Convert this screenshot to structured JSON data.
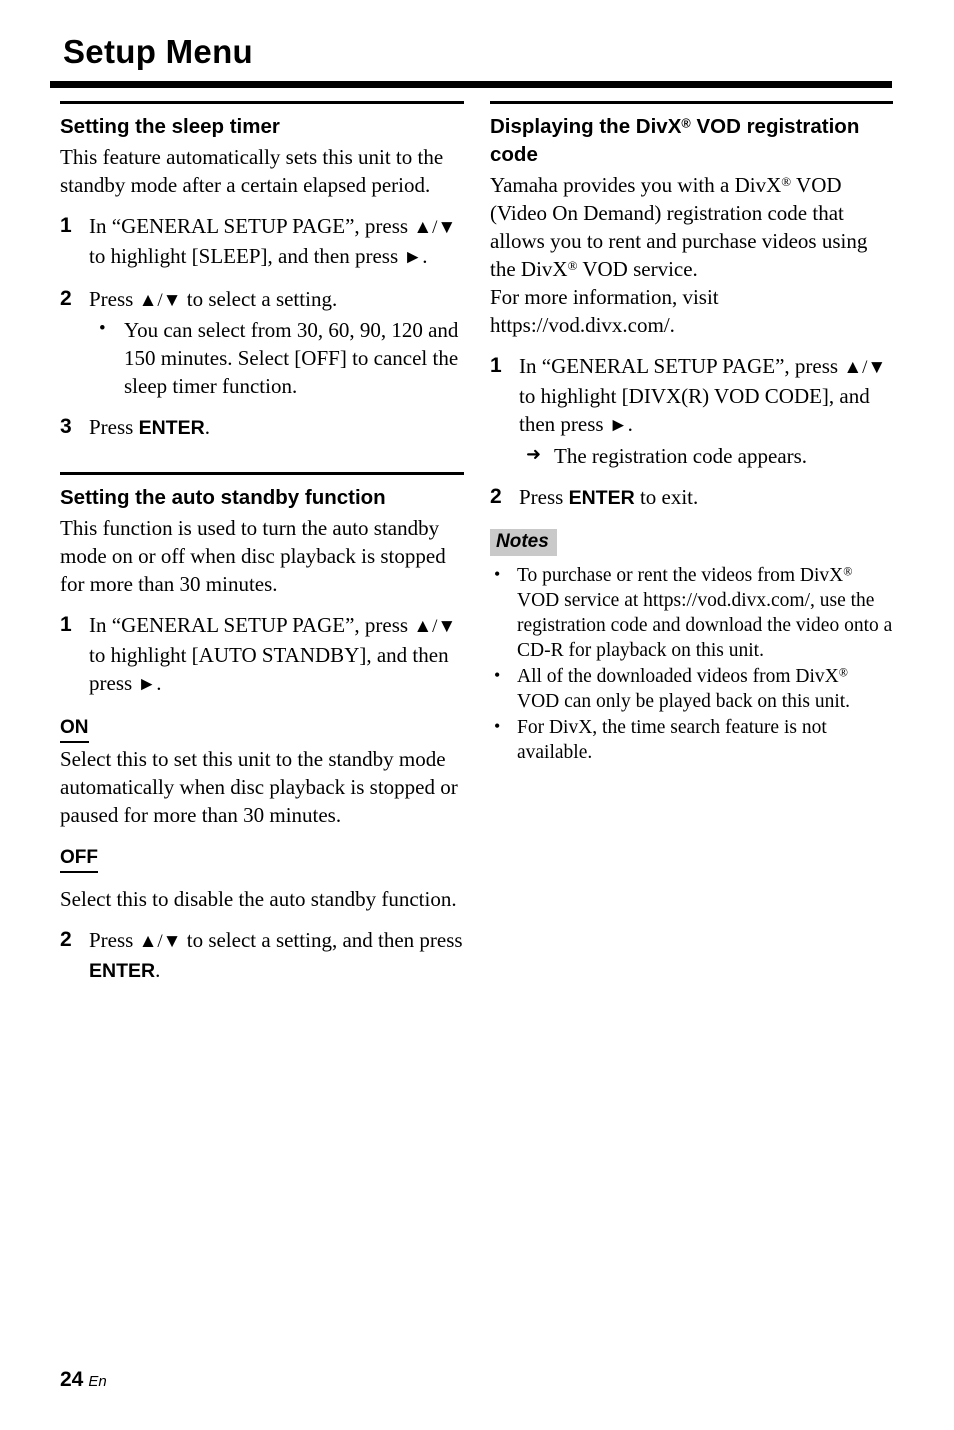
{
  "page": {
    "title": "Setup Menu",
    "footer_page_number": "24",
    "footer_language": "En"
  },
  "left_column": {
    "sections": [
      {
        "heading": "Setting the sleep timer",
        "intro": "This feature automatically sets this unit to the standby mode after a certain elapsed period.",
        "steps": [
          {
            "number": "1",
            "text_1": "In “GENERAL SETUP PAGE”, press ",
            "glyph_updown": "▲/▼",
            "text_2": " to highlight [SLEEP], and then press ",
            "glyph_right": "►",
            "text_3": "."
          },
          {
            "number": "2",
            "text_1": "Press ",
            "glyph_updown": "▲/▼",
            "text_2": " to select a setting.",
            "bullet": "•",
            "bullet_text": "You can select from 30, 60, 90, 120 and 150 minutes. Select [OFF] to cancel the sleep timer function."
          },
          {
            "number": "3",
            "text_1": "Press ",
            "kbd": "ENTER",
            "text_2": "."
          }
        ]
      },
      {
        "heading": "Setting the auto standby function",
        "intro": "This function is used to turn the auto standby mode on or off when disc playback is stopped for more than 30 minutes.",
        "steps": [
          {
            "number": "1",
            "text_1": "In “GENERAL SETUP PAGE”, press ",
            "glyph_updown": "▲/▼",
            "text_2": " to highlight [AUTO STANDBY], and then press ",
            "glyph_right": "►",
            "text_3": "."
          }
        ],
        "options": [
          {
            "label": "ON",
            "description": "Select this to set this unit to the standby mode automatically when disc playback is stopped or paused for more than 30 minutes."
          },
          {
            "label": "OFF",
            "description": "Select this to disable the auto standby function."
          }
        ],
        "final_step": {
          "number": "2",
          "text_1": "Press ",
          "glyph_updown": "▲/▼",
          "text_2": " to select a setting, and then press ",
          "kbd": "ENTER",
          "text_3": "."
        }
      }
    ]
  },
  "right_column": {
    "section": {
      "heading_part_1": "Displaying the DivX",
      "heading_reg": "®",
      "heading_part_2": " VOD registration code",
      "intro_1": "Yamaha provides you with a DivX",
      "intro_reg_1": "®",
      "intro_2": " VOD (Video On Demand) registration code that allows you to rent and purchase videos using the DivX",
      "intro_reg_2": "®",
      "intro_3": " VOD service.",
      "intro_4": "For more information, visit https://vod.divx.com/.",
      "steps": [
        {
          "number": "1",
          "text_1": "In “GENERAL SETUP PAGE”, press ",
          "glyph_updown": "▲/▼",
          "text_2": " to highlight [DIVX(R) VOD CODE], and then press ",
          "glyph_right": "►",
          "text_3": ".",
          "arrow": "➜",
          "result_text": "The registration code appears."
        },
        {
          "number": "2",
          "text_1": "Press ",
          "kbd": "ENTER",
          "text_2": " to exit."
        }
      ]
    },
    "notes": {
      "label": "Notes",
      "bullet": "•",
      "items": [
        {
          "text_1": "To purchase or rent the videos from DivX",
          "reg": "®",
          "text_2": " VOD service at https://vod.divx.com/, use the registration code and download the video onto a CD-R for playback on this unit."
        },
        {
          "text_1": "All of the downloaded videos from DivX",
          "reg": "®",
          "text_2": " VOD can only be played back on this unit."
        },
        {
          "text_1": "For DivX, the time search feature is not available.",
          "reg": "",
          "text_2": ""
        }
      ]
    }
  }
}
